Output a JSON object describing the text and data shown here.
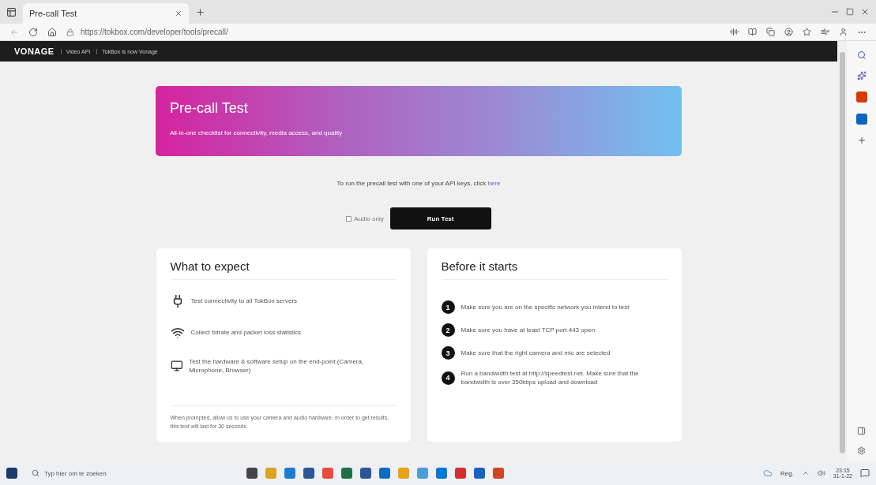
{
  "browser": {
    "tabs": [
      {
        "title": "Pre-call Test",
        "selected": true
      }
    ],
    "address": "https://tokbox.com/developer/tools/precall/"
  },
  "site_nav": {
    "brand": "VONAGE",
    "links": [
      "Video API",
      "TokBox is now Vonage"
    ]
  },
  "hero": {
    "title": "Pre-call Test",
    "subtitle": "All-in-one checklist for connectivity, media access, and quality"
  },
  "intro": {
    "text": "To run the precall test with one of your API keys, click ",
    "link": "here"
  },
  "controls": {
    "audio_only": {
      "label": "Audio only",
      "checked": false
    },
    "run_button": "Run Test"
  },
  "expect": {
    "title": "What to expect",
    "items": [
      {
        "kind": "plug",
        "text": "Test connectivity to all TokBox servers"
      },
      {
        "kind": "wifi",
        "text": "Collect bitrate and packet loss statistics"
      },
      {
        "kind": "monitor",
        "text": "Test the hardware & software setup on the end-point (Camera, Microphone, Browser)"
      }
    ],
    "note": "When prompted, allow us to use your camera and audio hardware. In order to get results, this test will last for 30 seconds."
  },
  "before": {
    "title": "Before it starts",
    "steps": [
      {
        "number": "1",
        "text": "Make sure you are on the specific network you intend to test"
      },
      {
        "number": "2",
        "text": "Make sure you have at least TCP port 443 open"
      },
      {
        "number": "3",
        "text": "Make sure that the right camera and mic are selected"
      },
      {
        "number": "4",
        "text": "Run a bandwidth test at http://speedtest.net. Make sure that the bandwidth is over 350kbps upload and download"
      }
    ]
  },
  "taskbar": {
    "search_placeholder": "Typ hier om te zoeken",
    "weather": "Reg.",
    "time": "23:15",
    "date": "31-1-22"
  }
}
